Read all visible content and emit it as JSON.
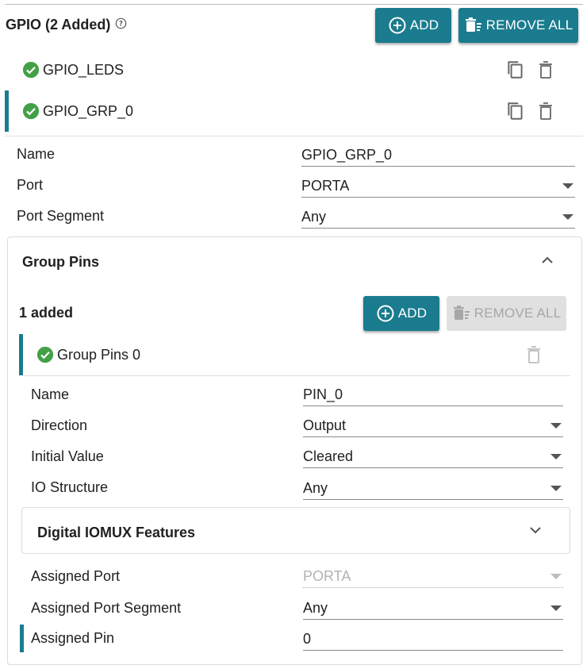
{
  "header": {
    "title": "GPIO (2 Added)",
    "add_label": "ADD",
    "remove_all_label": "REMOVE ALL"
  },
  "gpio_items": [
    {
      "name": "GPIO_LEDS"
    },
    {
      "name": "GPIO_GRP_0"
    }
  ],
  "form": {
    "name_label": "Name",
    "name_value": "GPIO_GRP_0",
    "port_label": "Port",
    "port_value": "PORTA",
    "segment_label": "Port Segment",
    "segment_value": "Any"
  },
  "group_pins": {
    "title": "Group Pins",
    "count_text": "1 added",
    "add_label": "ADD",
    "remove_all_label": "REMOVE ALL",
    "item_name": "Group Pins 0",
    "name_label": "Name",
    "name_value": "PIN_0",
    "direction_label": "Direction",
    "direction_value": "Output",
    "initial_label": "Initial Value",
    "initial_value": "Cleared",
    "io_label": "IO Structure",
    "io_value": "Any"
  },
  "iomux": {
    "title": "Digital IOMUX Features"
  },
  "assigned": {
    "port_label": "Assigned Port",
    "port_value": "PORTA",
    "segment_label": "Assigned Port Segment",
    "segment_value": "Any",
    "pin_label": "Assigned Pin",
    "pin_value": "0"
  },
  "colors": {
    "accent": "#1a7c8e",
    "success": "#43a047",
    "disabled": "#e0e0e0"
  }
}
